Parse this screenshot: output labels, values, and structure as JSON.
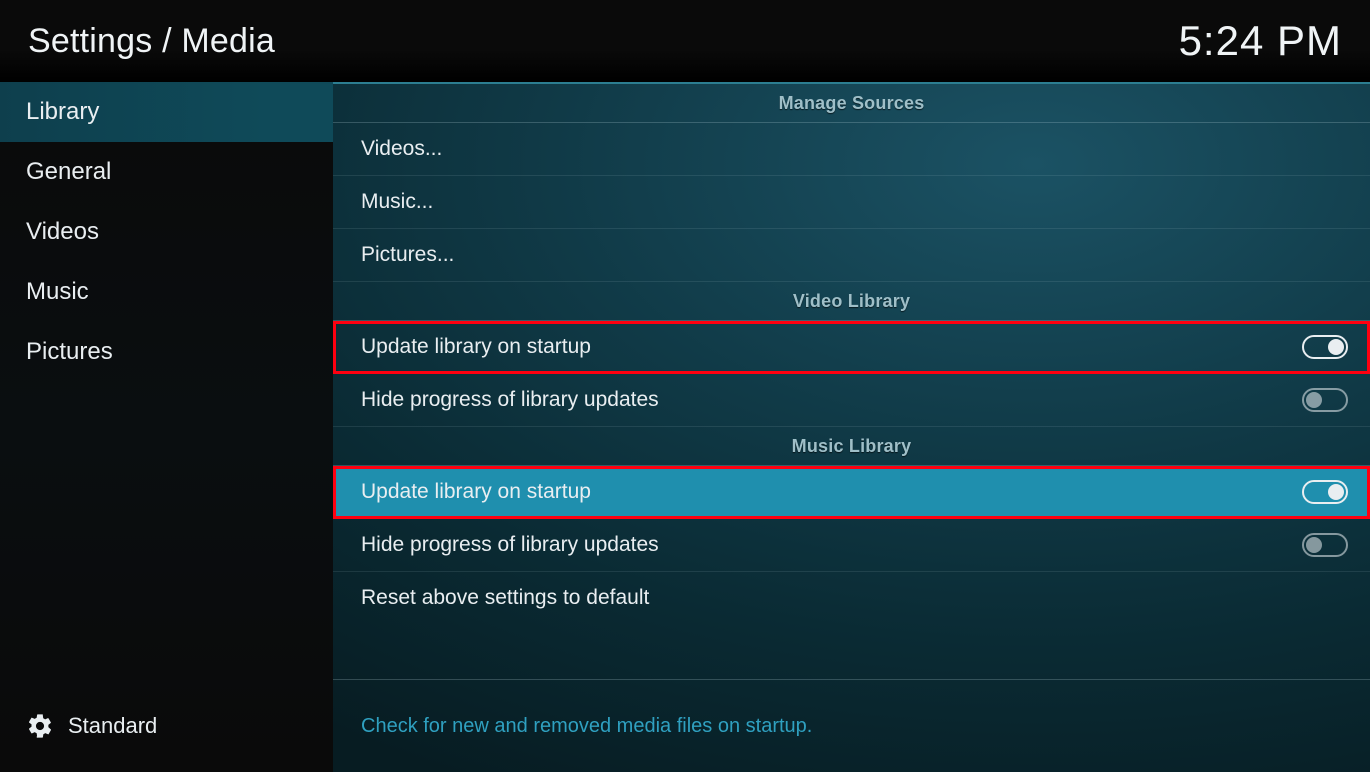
{
  "header": {
    "title": "Settings / Media",
    "clock": "5:24 PM"
  },
  "sidebar": {
    "items": [
      {
        "label": "Library",
        "active": true
      },
      {
        "label": "General",
        "active": false
      },
      {
        "label": "Videos",
        "active": false
      },
      {
        "label": "Music",
        "active": false
      },
      {
        "label": "Pictures",
        "active": false
      }
    ],
    "level_icon": "gear-icon",
    "level_label": "Standard"
  },
  "sections": {
    "manage_sources": {
      "title": "Manage Sources",
      "videos": "Videos...",
      "music": "Music...",
      "pictures": "Pictures..."
    },
    "video_library": {
      "title": "Video Library",
      "update_on_startup": {
        "label": "Update library on startup",
        "value": true,
        "highlighted": true
      },
      "hide_progress": {
        "label": "Hide progress of library updates",
        "value": false
      }
    },
    "music_library": {
      "title": "Music Library",
      "update_on_startup": {
        "label": "Update library on startup",
        "value": true,
        "highlighted": true,
        "selected": true
      },
      "hide_progress": {
        "label": "Hide progress of library updates",
        "value": false
      },
      "reset": {
        "label": "Reset above settings to default"
      }
    }
  },
  "help_text": "Check for new and removed media files on startup."
}
